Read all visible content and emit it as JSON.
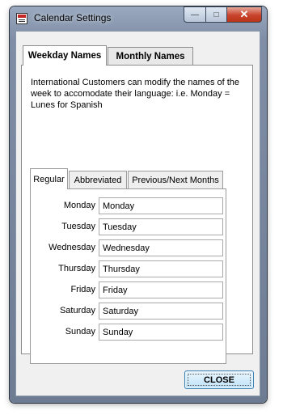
{
  "window": {
    "title": "Calendar Settings"
  },
  "caption": {
    "min": "—",
    "max": "□",
    "close": "✕"
  },
  "outer_tabs": [
    {
      "label": "Weekday Names",
      "active": true
    },
    {
      "label": "Monthly Names",
      "active": false
    }
  ],
  "description": "International Customers can modify the names of the week to accomodate their language:  i.e. Monday = Lunes for Spanish",
  "inner_tabs": [
    {
      "label": "Regular",
      "active": true
    },
    {
      "label": "Abbreviated",
      "active": false
    },
    {
      "label": "Previous/Next Months",
      "active": false
    }
  ],
  "days": [
    {
      "label": "Monday",
      "value": "Monday"
    },
    {
      "label": "Tuesday",
      "value": "Tuesday"
    },
    {
      "label": "Wednesday",
      "value": "Wednesday"
    },
    {
      "label": "Thursday",
      "value": "Thursday"
    },
    {
      "label": "Friday",
      "value": "Friday"
    },
    {
      "label": "Saturday",
      "value": "Saturday"
    },
    {
      "label": "Sunday",
      "value": "Sunday"
    }
  ],
  "close_button": "CLOSE"
}
